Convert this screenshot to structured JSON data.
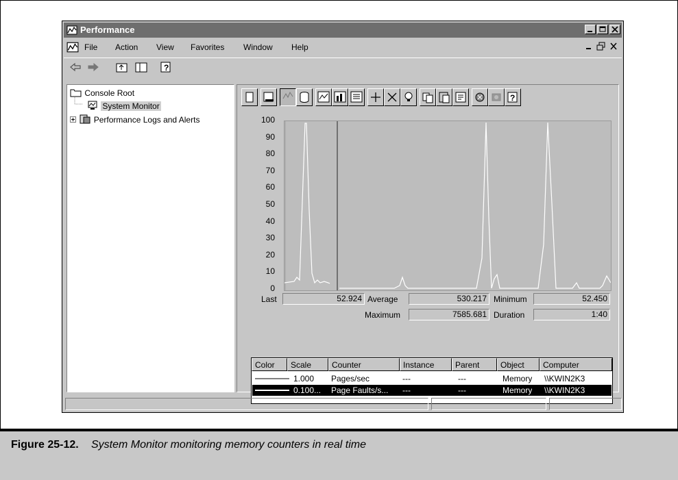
{
  "window": {
    "title": "Performance"
  },
  "menu": {
    "items": [
      {
        "label": "File"
      },
      {
        "label": "Action"
      },
      {
        "label": "View"
      },
      {
        "label": "Favorites"
      },
      {
        "label": "Window"
      },
      {
        "label": "Help"
      }
    ]
  },
  "tree": {
    "root": "Console Root",
    "items": [
      {
        "label": "System Monitor",
        "selected": true
      },
      {
        "label": "Performance Logs and Alerts"
      }
    ]
  },
  "graph": {
    "y_ticks": [
      "100",
      "90",
      "80",
      "70",
      "60",
      "50",
      "40",
      "30",
      "20",
      "10",
      "0"
    ]
  },
  "stats": {
    "last_label": "Last",
    "last_value": "52.924",
    "average_label": "Average",
    "average_value": "530.217",
    "minimum_label": "Minimum",
    "minimum_value": "52.450",
    "maximum_label": "Maximum",
    "maximum_value": "7585.681",
    "duration_label": "Duration",
    "duration_value": "1:40"
  },
  "counters": {
    "headers": [
      "Color",
      "Scale",
      "Counter",
      "Instance",
      "Parent",
      "Object",
      "Computer"
    ],
    "rows": [
      {
        "scale": "1.000",
        "counter": "Pages/sec",
        "instance": "---",
        "parent": "---",
        "object": "Memory",
        "computer": "\\\\KWIN2K3",
        "selected": false
      },
      {
        "scale": "0.100...",
        "counter": "Page Faults/s...",
        "instance": "---",
        "parent": "---",
        "object": "Memory",
        "computer": "\\\\KWIN2K3",
        "selected": true
      }
    ]
  },
  "caption": {
    "label": "Figure 25-12.",
    "text": "System Monitor monitoring memory counters in real time"
  },
  "colors": {
    "titlebar": "#6e6e6e",
    "window_bg": "#c6c6c6",
    "graph_bg": "#bdbdbd",
    "trace": "#ffffff"
  }
}
